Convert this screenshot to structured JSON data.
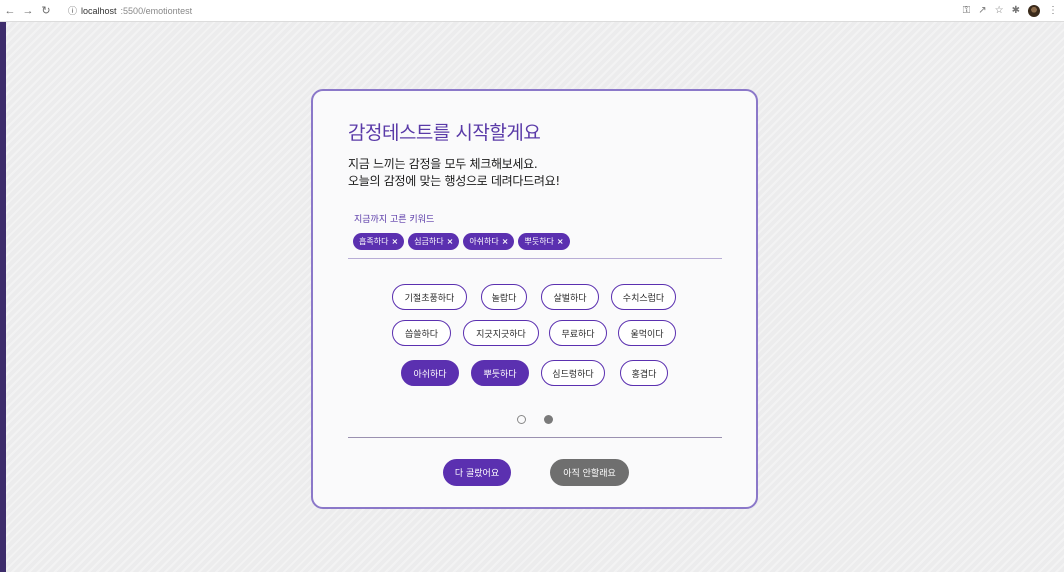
{
  "browser": {
    "url_host": "localhost",
    "url_path": ":5500/emotiontest"
  },
  "page": {
    "title": "감정테스트를 시작할게요",
    "subtitle_line1": "지금 느끼는 감정을 모두 체크해보세요.",
    "subtitle_line2": "오늘의 감정에 맞는 행성으로 데려다드려요!",
    "keywords_label": "지금까지 고른 키워드",
    "selected_chips": [
      "흡족하다",
      "심금하다",
      "아쉬하다",
      "뿌듯하다"
    ],
    "emotion_options": [
      {
        "label": "기절초풍하다",
        "selected": false
      },
      {
        "label": "놀랍다",
        "selected": false
      },
      {
        "label": "살벌하다",
        "selected": false
      },
      {
        "label": "수치스럽다",
        "selected": false
      },
      {
        "label": "씁쓸하다",
        "selected": false
      },
      {
        "label": "지긋지긋하다",
        "selected": false
      },
      {
        "label": "무료하다",
        "selected": false
      },
      {
        "label": "울먹이다",
        "selected": false
      },
      {
        "label": "아쉬하다",
        "selected": true
      },
      {
        "label": "뿌듯하다",
        "selected": true
      },
      {
        "label": "심드렁하다",
        "selected": false
      },
      {
        "label": "홍겹다",
        "selected": false
      }
    ],
    "pagination": {
      "current": 2,
      "total": 2
    },
    "done_button": "다 골랐어요",
    "not_yet_button": "아직 안할래요"
  },
  "colors": {
    "accent": "#5b30b0",
    "border": "#8b78c9",
    "secondary_button": "#6f6f6f"
  }
}
